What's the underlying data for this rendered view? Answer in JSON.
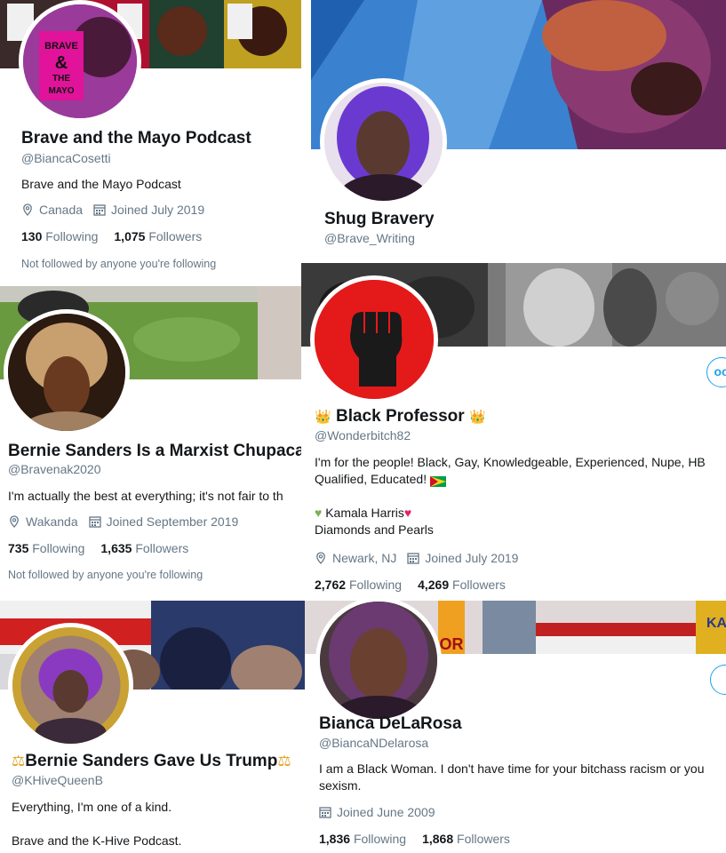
{
  "cards": [
    {
      "name": "Brave and the Mayo Podcast",
      "handle": "@BiancaCosetti",
      "bio": "Brave and the Mayo Podcast",
      "location": "Canada",
      "joined": "Joined July 2019",
      "following": "130",
      "following_label": "Following",
      "followers": "1,075",
      "followers_label": "Followers",
      "note": "Not followed by anyone you're following",
      "logo_text": "BRAVE & THE MAYO"
    },
    {
      "name": "Shug Bravery",
      "handle": "@Brave_Writing"
    },
    {
      "name": "Bernie Sanders Is a Marxist Chupacab",
      "handle": "@Bravenak2020",
      "bio": "I'm actually the best at everything; it's not fair to th",
      "location": "Wakanda",
      "joined": "Joined September 2019",
      "following": "735",
      "following_label": "Following",
      "followers": "1,635",
      "followers_label": "Followers",
      "note": "Not followed by anyone you're following"
    },
    {
      "name": "Black Professor",
      "handle": "@Wonderbitch82",
      "bio_line1": "I'm for the people! Black, Gay, Knowledgeable, Experienced, Nupe, HB",
      "bio_line2": "Qualified, Educated!",
      "bio_line3": "Kamala Harris",
      "bio_line4": "Diamonds and Pearls",
      "location": "Newark, NJ",
      "joined": "Joined July 2019",
      "following": "2,762",
      "following_label": "Following",
      "followers": "4,269",
      "followers_label": "Followers",
      "more": "oo"
    },
    {
      "name": "Bernie Sanders Gave Us Trump",
      "handle": "@KHiveQueenB",
      "bio_line1": "Everything, I'm one of a kind.",
      "bio_line2": "Brave and the K-Hive Podcast."
    },
    {
      "name": "Bianca DeLaRosa",
      "handle": "@BiancaNDelarosa",
      "bio_line1": "I am a Black Woman. I don't have time for your bitchass racism or you",
      "bio_line2": "sexism.",
      "joined": "Joined June 2009",
      "following": "1,836",
      "following_label": "Following",
      "followers": "1,868",
      "followers_label": "Followers",
      "banner_text": "OR",
      "banner_text2": "KA HA"
    }
  ],
  "colors": {
    "link_blue": "#1da1f2",
    "secondary_text": "#657786",
    "primary_text": "#14171a",
    "crown": "#f5b400",
    "heart_red": "#e0245e",
    "heart_green": "#77b255"
  }
}
